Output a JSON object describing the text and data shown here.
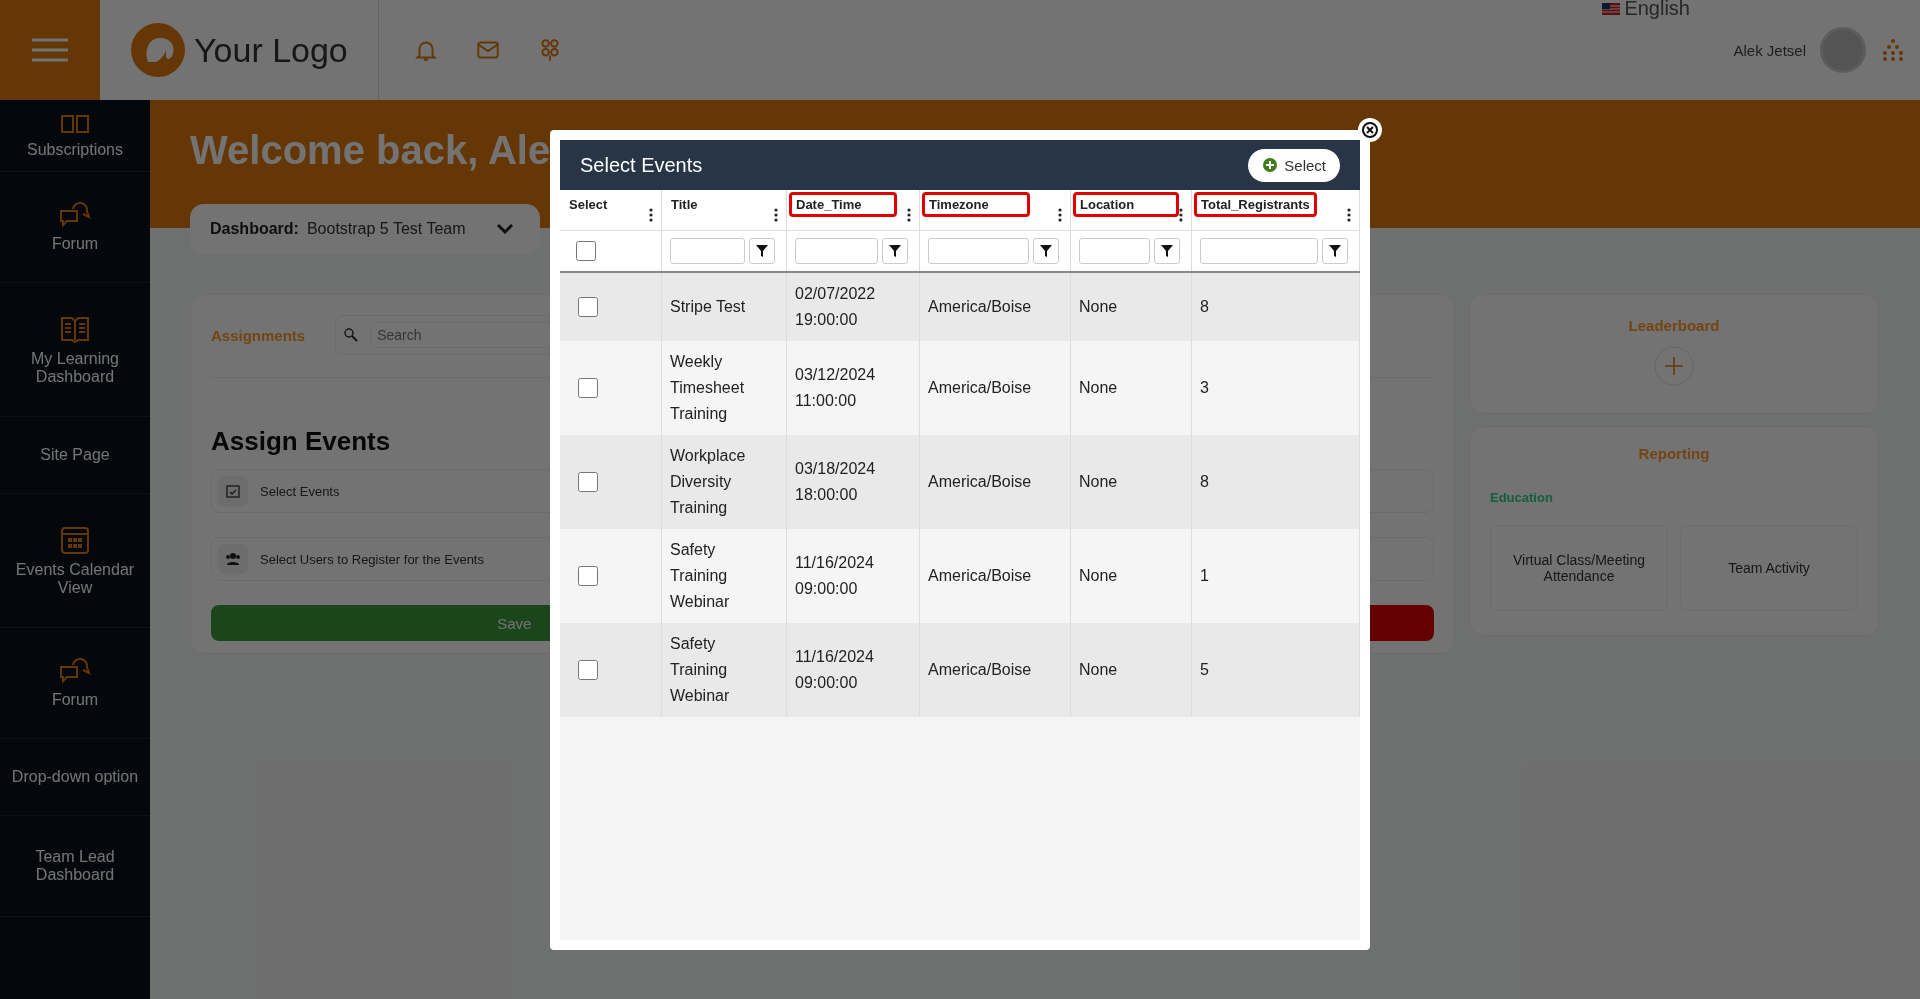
{
  "topbar": {
    "logo_text": "Your Logo",
    "language": "English",
    "user_name": "Alek Jetsel"
  },
  "sidebar": {
    "items": [
      {
        "label": "Subscriptions",
        "kind": "grid"
      },
      {
        "label": "Forum",
        "kind": "chat"
      },
      {
        "label": "My Learning Dashboard",
        "kind": "book"
      },
      {
        "label": "Site Page",
        "kind": "plain"
      },
      {
        "label": "Events Calendar View",
        "kind": "calendar"
      },
      {
        "label": "Forum",
        "kind": "chat"
      },
      {
        "label": "Drop-down option",
        "kind": "plain"
      },
      {
        "label": "Team Lead Dashboard",
        "kind": "plain"
      }
    ]
  },
  "welcome": "Welcome back, Ale",
  "dashboard_selector": {
    "label": "Dashboard:",
    "value": "Bootstrap 5 Test Team"
  },
  "assignments": {
    "tab": "Assignments",
    "search_placeholder": "Search",
    "heading": "Assign Events",
    "steps": [
      {
        "label": "Select Events",
        "kind": "calendar"
      },
      {
        "label": "Select Users to Register for the Events",
        "kind": "users"
      }
    ],
    "save_button": "Save"
  },
  "leaderboard": {
    "title": "Leaderboard"
  },
  "reporting": {
    "title": "Reporting",
    "section": "Education",
    "tiles": [
      "Virtual Class/Meeting Attendance",
      "Team Activity"
    ]
  },
  "modal": {
    "title": "Select Events",
    "select_button": "Select",
    "columns": [
      {
        "label": "Select",
        "highlighted": false,
        "kind": "checkbox",
        "checked": false
      },
      {
        "label": "Title",
        "highlighted": false,
        "kind": "text"
      },
      {
        "label": "Date_Time",
        "highlighted": true,
        "kind": "text"
      },
      {
        "label": "Timezone",
        "highlighted": true,
        "kind": "text"
      },
      {
        "label": "Location",
        "highlighted": true,
        "kind": "text"
      },
      {
        "label": "Total_Registrants",
        "highlighted": true,
        "kind": "text"
      }
    ],
    "rows": [
      {
        "selected": false,
        "title": "Stripe Test",
        "date": "02/07/2022 19:00:00",
        "timezone": "America/Boise",
        "location": "None",
        "total": "8"
      },
      {
        "selected": false,
        "title": "Weekly Timesheet Training",
        "date": "03/12/2024 11:00:00",
        "timezone": "America/Boise",
        "location": "None",
        "total": "3"
      },
      {
        "selected": false,
        "title": "Workplace Diversity Training",
        "date": "03/18/2024 18:00:00",
        "timezone": "America/Boise",
        "location": "None",
        "total": "8"
      },
      {
        "selected": false,
        "title": "Safety Training Webinar",
        "date": "11/16/2024 09:00:00",
        "timezone": "America/Boise",
        "location": "None",
        "total": "1"
      },
      {
        "selected": false,
        "title": "Safety Training Webinar",
        "date": "11/16/2024 09:00:00",
        "timezone": "America/Boise",
        "location": "None",
        "total": "5"
      }
    ]
  }
}
